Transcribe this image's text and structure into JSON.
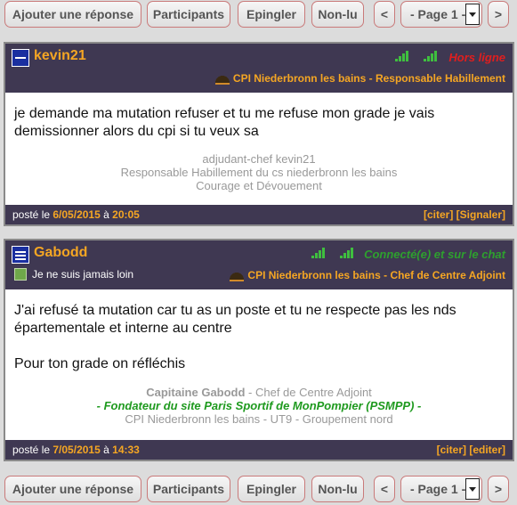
{
  "toolbar": {
    "reply": "Ajouter une réponse",
    "participants": "Participants",
    "pin": "Epingler",
    "unread": "Non-lu",
    "prev": "<",
    "page": "- Page 1 -",
    "next": ">"
  },
  "posts": [
    {
      "user": "kevin21",
      "status": "Hors ligne",
      "cpi": "CPI Niederbronn les bains - Responsable Habillement",
      "message": [
        "je demande ma mutation refuser et tu me refuse mon grade je vais demissionner alors du cpi si tu veux sa"
      ],
      "signature": {
        "line1": "adjudant-chef kevin21",
        "line2": "Responsable Habillement du cs niederbronn les bains",
        "line3": "Courage et Dévouement"
      },
      "posted_label": "posté le",
      "date": "6/05/2015",
      "at": "à",
      "time": "20:05",
      "link1": "[citer]",
      "link2": "[Signaler]"
    },
    {
      "user": "Gabodd",
      "status": "Connecté(e) et sur le chat",
      "quote": "Je ne suis jamais loin",
      "cpi": "CPI Niederbronn les bains - Chef de Centre Adjoint",
      "message": [
        "J'ai refusé ta mutation car tu as un poste et tu ne respecte pas les nds épartementale et interne au centre",
        "Pour ton grade on réfléchis"
      ],
      "signature": {
        "name": "Capitaine Gabodd",
        "role": " - Chef de Centre Adjoint",
        "line2": "- Fondateur du site Paris Sportif de MonPompier (PSMPP) -",
        "line3": "CPI Niederbronn les bains - UT9 - Groupement nord"
      },
      "posted_label": "posté le",
      "date": "7/05/2015",
      "at": "à",
      "time": "14:33",
      "link1": "[citer]",
      "link2": "[editer]"
    }
  ]
}
